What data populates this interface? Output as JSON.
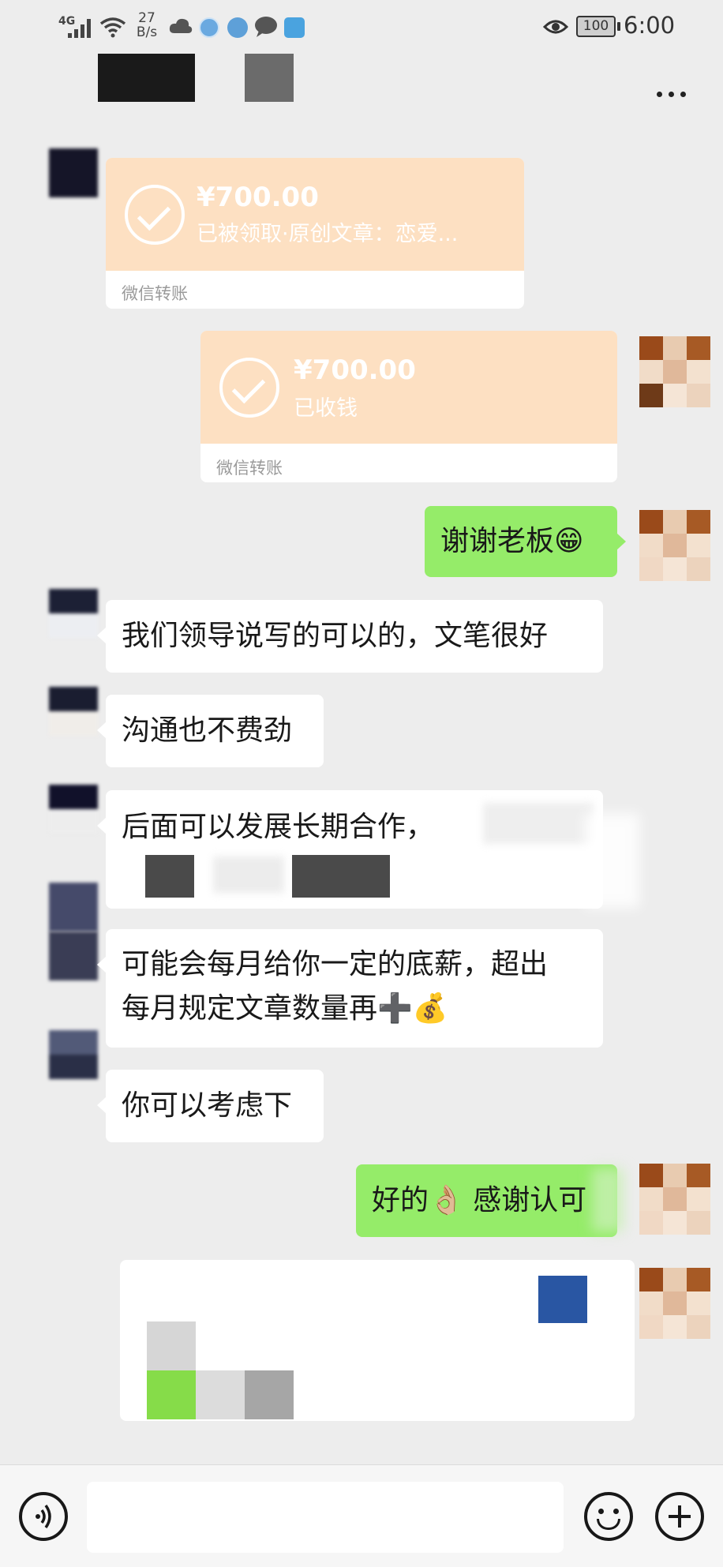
{
  "status_bar": {
    "network": "4G",
    "speed_value": "27",
    "speed_unit": "B/s",
    "battery": "100",
    "time": "6:00"
  },
  "header": {
    "more_label": "⋯"
  },
  "messages": {
    "transfer_in": {
      "amount": "¥700.00",
      "status": "已被领取·原创文章：恋爱...",
      "footer": "微信转账"
    },
    "transfer_out": {
      "amount": "¥700.00",
      "status": "已收钱",
      "footer": "微信转账"
    },
    "thanks": {
      "text": "谢谢老板😁"
    },
    "m1": {
      "text": "我们领导说写的可以的，文笔很好"
    },
    "m2": {
      "text": "沟通也不费劲"
    },
    "m3": {
      "text": "后面可以发展长期合作，"
    },
    "m4_line1": {
      "text": "可能会每月给你一定的底薪，超出"
    },
    "m4_line2": {
      "text": "每月规定文章数量再➕💰"
    },
    "m5": {
      "text": "你可以考虑下"
    },
    "m6": {
      "text": "好的👌🏼 感谢认可"
    }
  },
  "bottom_bar": {
    "voice_icon": "voice-icon",
    "emoji_icon": "emoji-icon",
    "plus_icon": "plus-icon"
  }
}
